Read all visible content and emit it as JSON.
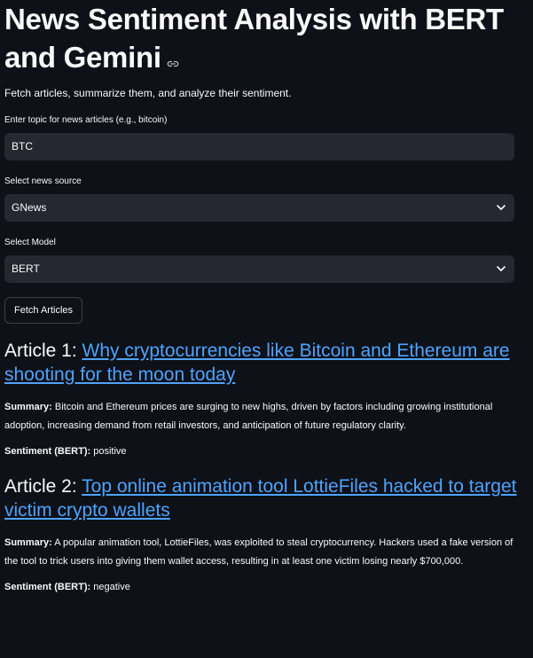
{
  "header": {
    "title": "News Sentiment Analysis with BERT and Gemini",
    "subtitle": "Fetch articles, summarize them, and analyze their sentiment."
  },
  "topic": {
    "label": "Enter topic for news articles (e.g., bitcoin)",
    "value": "BTC"
  },
  "source": {
    "label": "Select news source",
    "selected": "GNews"
  },
  "model": {
    "label": "Select Model",
    "selected": "BERT"
  },
  "fetch_button": {
    "label": "Fetch Articles"
  },
  "articles": [
    {
      "prefix": "Article 1:",
      "link_text": "Why cryptocurrencies like Bitcoin and Ethereum are shooting for the moon today",
      "summary_label": "Summary:",
      "summary_text": "Bitcoin and Ethereum prices are surging to new highs, driven by factors including growing institutional adoption, increasing demand from retail investors, and anticipation of future regulatory clarity.",
      "sentiment_label": "Sentiment (BERT):",
      "sentiment_value": "positive"
    },
    {
      "prefix": "Article 2:",
      "link_text": "Top online animation tool LottieFiles hacked to target victim crypto wallets",
      "summary_label": "Summary:",
      "summary_text": "A popular animation tool, LottieFiles, was exploited to steal cryptocurrency. Hackers used a fake version of the tool to trick users into giving them wallet access, resulting in at least one victim losing nearly $700,000.",
      "sentiment_label": "Sentiment (BERT):",
      "sentiment_value": "negative"
    }
  ],
  "colors": {
    "background": "#0e1117",
    "input_background": "#262730",
    "link": "#4ea3ff",
    "text": "#fafafa"
  },
  "icons": {
    "title_anchor": "link-icon",
    "select_chevron": "chevron-down-icon"
  }
}
